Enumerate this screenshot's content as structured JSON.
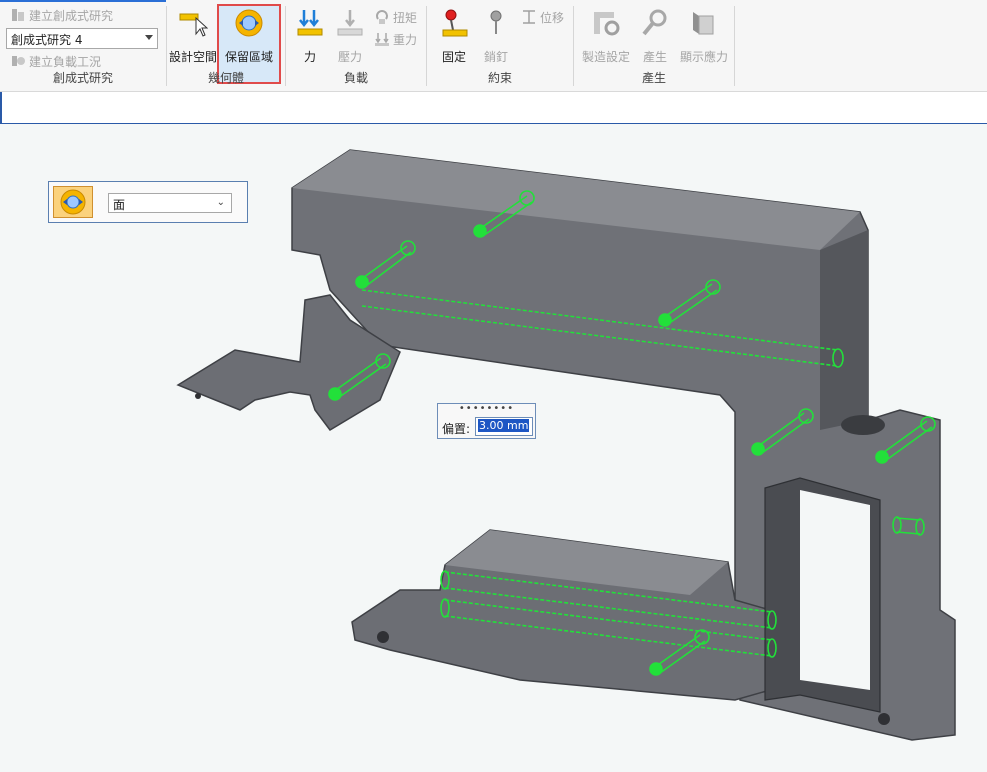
{
  "ribbon": {
    "study_group": {
      "create_study": "建立創成式研究",
      "selected_study": "創成式研究 4",
      "create_load_case": "建立負載工況",
      "label": "創成式研究"
    },
    "geometry_group": {
      "design_space": "設計空間",
      "preserve_region": "保留區域",
      "label": "幾何體"
    },
    "loads_group": {
      "force": "力",
      "pressure": "壓力",
      "torque": "扭矩",
      "gravity": "重力",
      "label": "負載"
    },
    "constraints_group": {
      "fixed": "固定",
      "pin": "銷釘",
      "displacement": "位移",
      "label": "約束"
    },
    "generate_group": {
      "manufacturing_settings": "製造設定",
      "generate": "產生",
      "show_stress": "顯示應力",
      "label": "產生"
    }
  },
  "face_panel": {
    "selection_type": "面"
  },
  "offset_box": {
    "grip": "••••••••",
    "label": "偏置:",
    "value": "3.00 mm"
  },
  "colors": {
    "accent_blue": "#2a6fd6",
    "highlight_red": "#e04a4a",
    "part_gray": "#6f7177",
    "preserve_green": "#22e03a"
  }
}
